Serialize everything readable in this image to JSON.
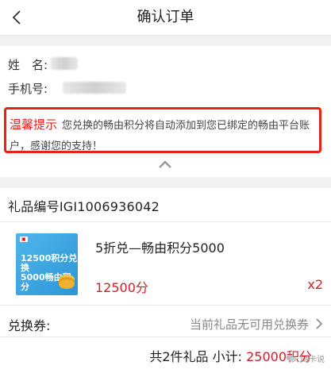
{
  "header": {
    "title": "确认订单",
    "back_icon": "chevron-left-icon"
  },
  "contact": {
    "name_label": "姓　名:",
    "phone_label": "手机号:"
  },
  "notice": {
    "title": "温馨提示",
    "text": "您兑换的畅由积分将自动添加到您已绑定的畅由平台账户，感谢您的支持！",
    "border_color": "#e5231b"
  },
  "order": {
    "gift_no_label": "礼品编号",
    "gift_no": "IGI1006936042",
    "product": {
      "name": "5折兑—畅由积分5000",
      "price": "12500分",
      "quantity": "x2",
      "thumbnail": {
        "line1": "12500积分兑换",
        "line2": "5000畅由积分"
      }
    },
    "coupon_label": "兑换券:",
    "coupon_value": "当前礼品无可用兑换券",
    "summary_prefix": "共2件礼品 小计:",
    "summary_total": "25000积分",
    "accent_color": "#d0202a"
  },
  "watermark": {
    "text": "TA卡说",
    "icon": "wechat-icon"
  }
}
